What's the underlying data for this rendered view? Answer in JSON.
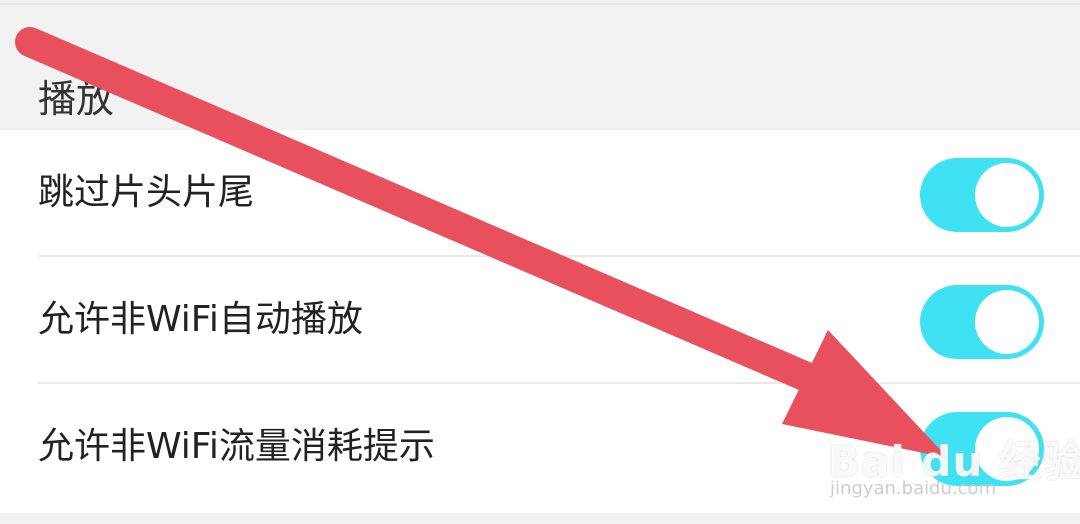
{
  "section": {
    "title": "播放"
  },
  "settings": {
    "items": [
      {
        "label": "跳过片头片尾",
        "toggle_on": true
      },
      {
        "label": "允许非WiFi自动播放",
        "toggle_on": true
      },
      {
        "label": "允许非WiFi流量消耗提示",
        "toggle_on": true
      }
    ]
  },
  "colors": {
    "toggle_on": "#3ee2f2",
    "arrow": "#e8505e",
    "background": "#f2f2f2"
  },
  "watermark": {
    "logo": "Bai du 经验",
    "url": "jingyan.baidu.com"
  }
}
